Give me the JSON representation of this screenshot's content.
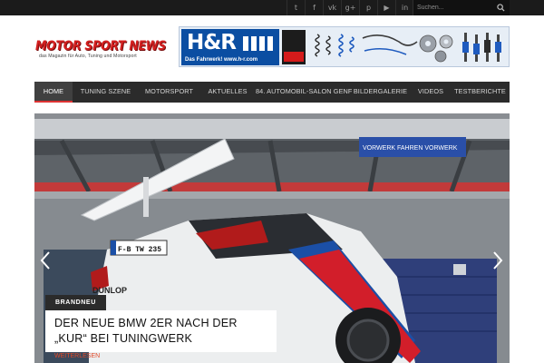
{
  "topbar": {
    "social_icons": [
      "twitter-icon",
      "facebook-icon",
      "vk-icon",
      "google-plus-icon",
      "pinterest-icon",
      "youtube-icon",
      "linkedin-icon"
    ],
    "social_labels": [
      "t",
      "f",
      "vk",
      "g+",
      "p",
      "▶",
      "in"
    ],
    "search": {
      "placeholder": "Suchen..."
    }
  },
  "header": {
    "logo_title": "MOTOR SPORT NEWS",
    "logo_subtitle": "das Magazin für Auto, Tuning und Motorsport",
    "banner": {
      "brand": "H&R",
      "tagline": "Das Fahrwerk! www.h-r.com"
    }
  },
  "nav": {
    "items": [
      {
        "label": "Home",
        "active": true
      },
      {
        "label": "Tuning Szene",
        "active": false
      },
      {
        "label": "Motorsport",
        "active": false
      },
      {
        "label": "Aktuelles",
        "active": false
      },
      {
        "label": "84. Automobil-Salon Genf",
        "active": false
      },
      {
        "label": "Bildergalerie",
        "active": false
      },
      {
        "label": "Videos",
        "active": false
      },
      {
        "label": "Testberichte",
        "active": false
      }
    ]
  },
  "slider": {
    "category": "BRANDNEU",
    "headline": "Der neue BMW 2er nach der „Kur“ bei Tuningwerk",
    "readmore": "weiterlesen"
  },
  "colors": {
    "accent": "#d33333",
    "topbar": "#1b1b1b",
    "nav": "#2b2b2b",
    "banner_blue": "#0b4ea2"
  }
}
